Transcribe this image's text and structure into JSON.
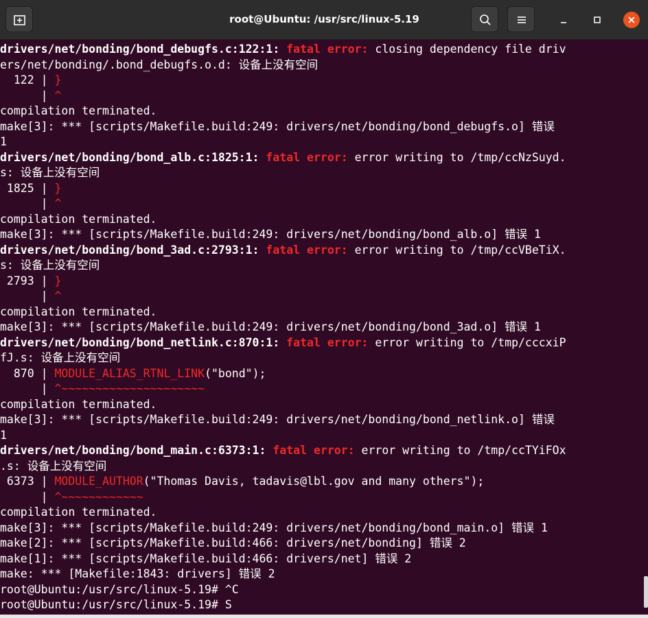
{
  "window": {
    "title": "root@Ubuntu: /usr/src/linux-5.19",
    "new_tab_icon": "new-tab-icon",
    "search_icon": "search-icon",
    "menu_icon": "hamburger-menu-icon",
    "minimize_icon": "minimize-icon",
    "maximize_icon": "maximize-icon",
    "close_icon": "close-icon",
    "close_color": "#e95420",
    "titlebar_color": "#2d2d2d"
  },
  "terminal": {
    "background": "#300a24",
    "error_color": "#ef2929",
    "lines": [
      [
        {
          "t": "drivers/net/bonding/bond_debugfs.c:122:1: ",
          "b": true
        },
        {
          "t": "fatal error:",
          "c": "red",
          "b": true
        },
        {
          "t": " closing dependency file driv"
        }
      ],
      [
        {
          "t": "ers/net/bonding/.bond_debugfs.o.d: 设备上没有空间"
        }
      ],
      [
        {
          "t": "  122 | "
        },
        {
          "t": "}",
          "c": "red"
        }
      ],
      [
        {
          "t": "      | "
        },
        {
          "t": "^",
          "c": "red"
        }
      ],
      [
        {
          "t": "compilation terminated."
        }
      ],
      [
        {
          "t": "make[3]: *** [scripts/Makefile.build:249: drivers/net/bonding/bond_debugfs.o] 错误"
        }
      ],
      [
        {
          "t": "1"
        }
      ],
      [
        {
          "t": "drivers/net/bonding/bond_alb.c:1825:1: ",
          "b": true
        },
        {
          "t": "fatal error:",
          "c": "red",
          "b": true
        },
        {
          "t": " error writing to /tmp/ccNzSuyd."
        }
      ],
      [
        {
          "t": "s: 设备上没有空间"
        }
      ],
      [
        {
          "t": " 1825 | "
        },
        {
          "t": "}",
          "c": "red"
        }
      ],
      [
        {
          "t": "      | "
        },
        {
          "t": "^",
          "c": "red"
        }
      ],
      [
        {
          "t": "compilation terminated."
        }
      ],
      [
        {
          "t": "make[3]: *** [scripts/Makefile.build:249: drivers/net/bonding/bond_alb.o] 错误 1"
        }
      ],
      [
        {
          "t": "drivers/net/bonding/bond_3ad.c:2793:1: ",
          "b": true
        },
        {
          "t": "fatal error:",
          "c": "red",
          "b": true
        },
        {
          "t": " error writing to /tmp/ccVBeTiX."
        }
      ],
      [
        {
          "t": "s: 设备上没有空间"
        }
      ],
      [
        {
          "t": " 2793 | "
        },
        {
          "t": "}",
          "c": "red"
        }
      ],
      [
        {
          "t": "      | "
        },
        {
          "t": "^",
          "c": "red"
        }
      ],
      [
        {
          "t": "compilation terminated."
        }
      ],
      [
        {
          "t": "make[3]: *** [scripts/Makefile.build:249: drivers/net/bonding/bond_3ad.o] 错误 1"
        }
      ],
      [
        {
          "t": "drivers/net/bonding/bond_netlink.c:870:1: ",
          "b": true
        },
        {
          "t": "fatal error:",
          "c": "red",
          "b": true
        },
        {
          "t": " error writing to /tmp/cccxiP"
        }
      ],
      [
        {
          "t": "fJ.s: 设备上没有空间"
        }
      ],
      [
        {
          "t": "  870 | "
        },
        {
          "t": "MODULE_ALIAS_RTNL_LINK",
          "c": "red"
        },
        {
          "t": "(\"bond\");"
        }
      ],
      [
        {
          "t": "      | "
        },
        {
          "t": "^~~~~~~~~~~~~~~~~~~~~~",
          "c": "red"
        }
      ],
      [
        {
          "t": "compilation terminated."
        }
      ],
      [
        {
          "t": "make[3]: *** [scripts/Makefile.build:249: drivers/net/bonding/bond_netlink.o] 错误"
        }
      ],
      [
        {
          "t": "1"
        }
      ],
      [
        {
          "t": "drivers/net/bonding/bond_main.c:6373:1: ",
          "b": true
        },
        {
          "t": "fatal error:",
          "c": "red",
          "b": true
        },
        {
          "t": " error writing to /tmp/ccTYiFOx"
        }
      ],
      [
        {
          "t": ".s: 设备上没有空间"
        }
      ],
      [
        {
          "t": " 6373 | "
        },
        {
          "t": "MODULE_AUTHOR",
          "c": "red"
        },
        {
          "t": "(\"Thomas Davis, tadavis@lbl.gov and many others\");"
        }
      ],
      [
        {
          "t": "      | "
        },
        {
          "t": "^~~~~~~~~~~~~",
          "c": "red"
        }
      ],
      [
        {
          "t": "compilation terminated."
        }
      ],
      [
        {
          "t": "make[3]: *** [scripts/Makefile.build:249: drivers/net/bonding/bond_main.o] 错误 1"
        }
      ],
      [
        {
          "t": "make[2]: *** [scripts/Makefile.build:466: drivers/net/bonding] 错误 2"
        }
      ],
      [
        {
          "t": "make[1]: *** [scripts/Makefile.build:466: drivers/net] 错误 2"
        }
      ],
      [
        {
          "t": "make: *** [Makefile:1843: drivers] 错误 2"
        }
      ],
      [
        {
          "t": "root@Ubuntu:/usr/src/linux-5.19# ^C"
        }
      ],
      [
        {
          "t": "root@Ubuntu:/usr/src/linux-5.19# S"
        }
      ]
    ]
  }
}
